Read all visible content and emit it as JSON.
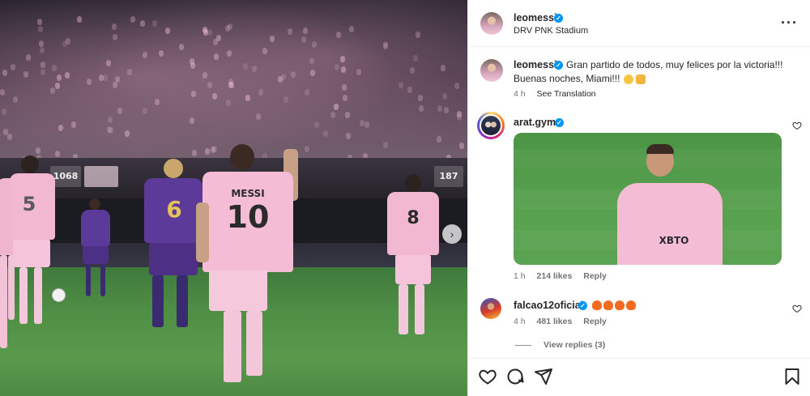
{
  "post": {
    "photo": {
      "jerseys": {
        "main_name": "MESSI",
        "main_number": "10",
        "left_number": "5",
        "opponent_number": "6",
        "right_number": "8",
        "board_left": "1068",
        "board_right": "187"
      }
    },
    "header": {
      "username": "leomessi",
      "location": "DRV PNK Stadium",
      "more_icon": "more-options-icon"
    },
    "caption": {
      "username": "leomessi",
      "text_line1": "Gran partido de todos, muy felices por la victoria!!!",
      "text_line2": "Buenas noches, Miami!!!",
      "time": "4 h",
      "translate": "See Translation"
    },
    "comments": [
      {
        "username": "arat.gym",
        "gif_text": "XBTO",
        "time": "1 h",
        "likes": "214 likes",
        "reply": "Reply"
      },
      {
        "username": "falcao12oficial",
        "time": "4 h",
        "likes": "481 likes",
        "reply": "Reply",
        "view_replies": "View replies (3)"
      }
    ],
    "colors": {
      "verified": "#0095f6",
      "pink_kit": "#f2b8d2",
      "purple_kit": "#5b3a9a",
      "pitch": "#4f8f45"
    },
    "icons": [
      "like-icon",
      "comment-icon",
      "share-icon",
      "save-icon",
      "next-image-icon",
      "verified-badge-icon",
      "comment-heart-icon"
    ]
  }
}
